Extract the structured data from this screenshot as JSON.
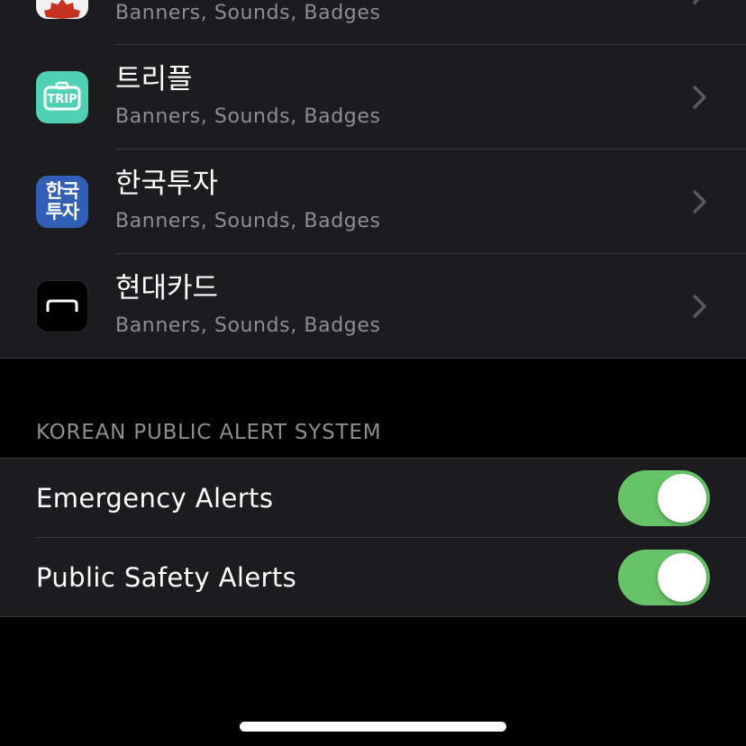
{
  "apps": [
    {
      "name": "",
      "subtitle": "Banners, Sounds, Badges",
      "icon": "red-badge-app-icon"
    },
    {
      "name": "트리플",
      "subtitle": "Banners, Sounds, Badges",
      "icon": "triple-trip-icon",
      "icon_text": "TRIP"
    },
    {
      "name": "한국투자",
      "subtitle": "Banners, Sounds, Badges",
      "icon": "korea-investment-icon",
      "icon_text": "한국투자"
    },
    {
      "name": "현대카드",
      "subtitle": "Banners, Sounds, Badges",
      "icon": "hyundai-card-icon"
    }
  ],
  "alert_section": {
    "header": "KOREAN PUBLIC ALERT SYSTEM",
    "items": [
      {
        "label": "Emergency Alerts",
        "enabled": true
      },
      {
        "label": "Public Safety Alerts",
        "enabled": true
      }
    ]
  },
  "colors": {
    "background": "#000000",
    "cell": "#1c1c1e",
    "separator": "#3a3a3c",
    "secondary_text": "#8e8e93",
    "toggle_on": "#65c466",
    "trip_icon": "#4fd1b4",
    "korea_investment_icon": "#2f5fb6"
  }
}
